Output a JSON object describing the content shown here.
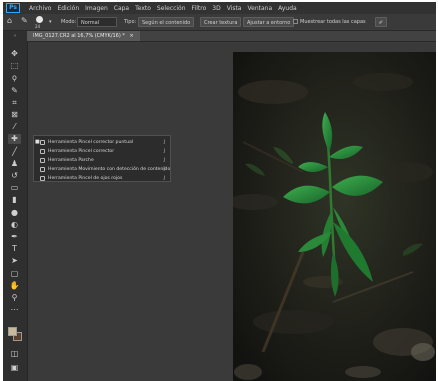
{
  "app": {
    "logo": "Ps"
  },
  "menu": [
    "Archivo",
    "Edición",
    "Imagen",
    "Capa",
    "Texto",
    "Selección",
    "Filtro",
    "3D",
    "Vista",
    "Ventana",
    "Ayuda"
  ],
  "options": {
    "brush_size": "24",
    "mode_label": "Modo:",
    "mode_value": "Normal",
    "type_label": "Tipo:",
    "btn_content": "Según el contenido",
    "btn_texture": "Crear textura",
    "btn_proximity": "Ajustar a entorno",
    "sample_all": "Muestrear todas las capas"
  },
  "document": {
    "tab_title": "IMG_0127.CR2 al 16,7% (CMYK/16) *",
    "close": "×"
  },
  "flyout": {
    "items": [
      {
        "label": "Herramienta Pincel corrector puntual",
        "key": "J",
        "active": true,
        "icon": "spot-healing-icon"
      },
      {
        "label": "Herramienta Pincel corrector",
        "key": "J",
        "active": false,
        "icon": "healing-brush-icon"
      },
      {
        "label": "Herramienta Parche",
        "key": "J",
        "active": false,
        "icon": "patch-icon"
      },
      {
        "label": "Herramienta Movimiento con detección de contenido",
        "key": "J",
        "active": false,
        "icon": "content-aware-move-icon"
      },
      {
        "label": "Herramienta Pincel de ojos rojos",
        "key": "J",
        "active": false,
        "icon": "red-eye-icon"
      }
    ]
  },
  "colors": {
    "foreground": "#c8b89a",
    "background": "#5a3e28",
    "accent": "#31a8ff"
  },
  "toolbar_icons": [
    "move-icon",
    "marquee-icon",
    "lasso-icon",
    "quick-select-icon",
    "crop-icon",
    "frame-icon",
    "eyedropper-icon",
    "healing-icon",
    "brush-icon",
    "stamp-icon",
    "history-brush-icon",
    "eraser-icon",
    "gradient-icon",
    "blur-icon",
    "dodge-icon",
    "pen-icon",
    "type-icon",
    "path-select-icon",
    "rectangle-icon",
    "hand-icon",
    "zoom-icon",
    "more-icon"
  ]
}
